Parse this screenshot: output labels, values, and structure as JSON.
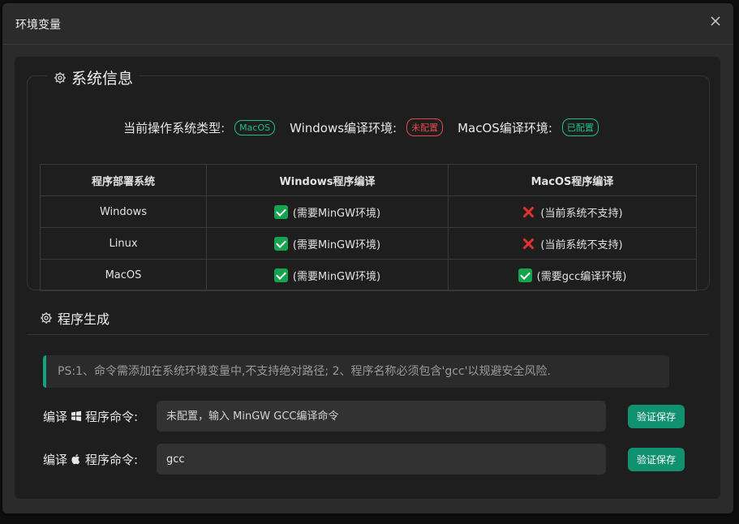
{
  "dialog": {
    "title": "环境变量",
    "close_icon": "close-icon"
  },
  "system_info": {
    "heading": "系统信息",
    "os_type_label": "当前操作系统类型:",
    "os_type_value": "MacOS",
    "windows_env_label": "Windows编译环境:",
    "windows_env_status": "未配置",
    "macos_env_label": "MacOS编译环境:",
    "macos_env_status": "已配置",
    "colors": {
      "configured": "#1fbf8a",
      "not_configured": "#e5484d",
      "accent": "#10916f"
    },
    "table": {
      "headers": [
        "程序部署系统",
        "Windows程序编译",
        "MacOS程序编译"
      ],
      "rows": [
        {
          "system": "Windows",
          "win": "(需要MinGW环境)",
          "win_icon": "check-icon",
          "mac": "(当前系统不支持)",
          "mac_icon": "cross-icon"
        },
        {
          "system": "Linux",
          "win": "(需要MinGW环境)",
          "win_icon": "check-icon",
          "mac": "(当前系统不支持)",
          "mac_icon": "cross-icon"
        },
        {
          "system": "MacOS",
          "win": "(需要MinGW环境)",
          "win_icon": "check-icon",
          "mac": "(需要gcc编译环境)",
          "mac_icon": "check-icon"
        }
      ]
    }
  },
  "program_gen": {
    "heading": "程序生成",
    "notice": "PS:1、命令需添加在系统环境变量中,不支持绝对路径;  2、程序名称必须包含'gcc'以规避安全风险.",
    "win_label_prefix": "编译",
    "win_label_suffix": "程序命令:",
    "win_icon": "windows-icon",
    "win_placeholder": "未配置，输入 MinGW GCC编译命令",
    "win_value": "",
    "mac_label_prefix": "编译",
    "mac_label_suffix": "程序命令:",
    "mac_icon": "apple-icon",
    "mac_value": "gcc",
    "save_label": "验证保存"
  }
}
